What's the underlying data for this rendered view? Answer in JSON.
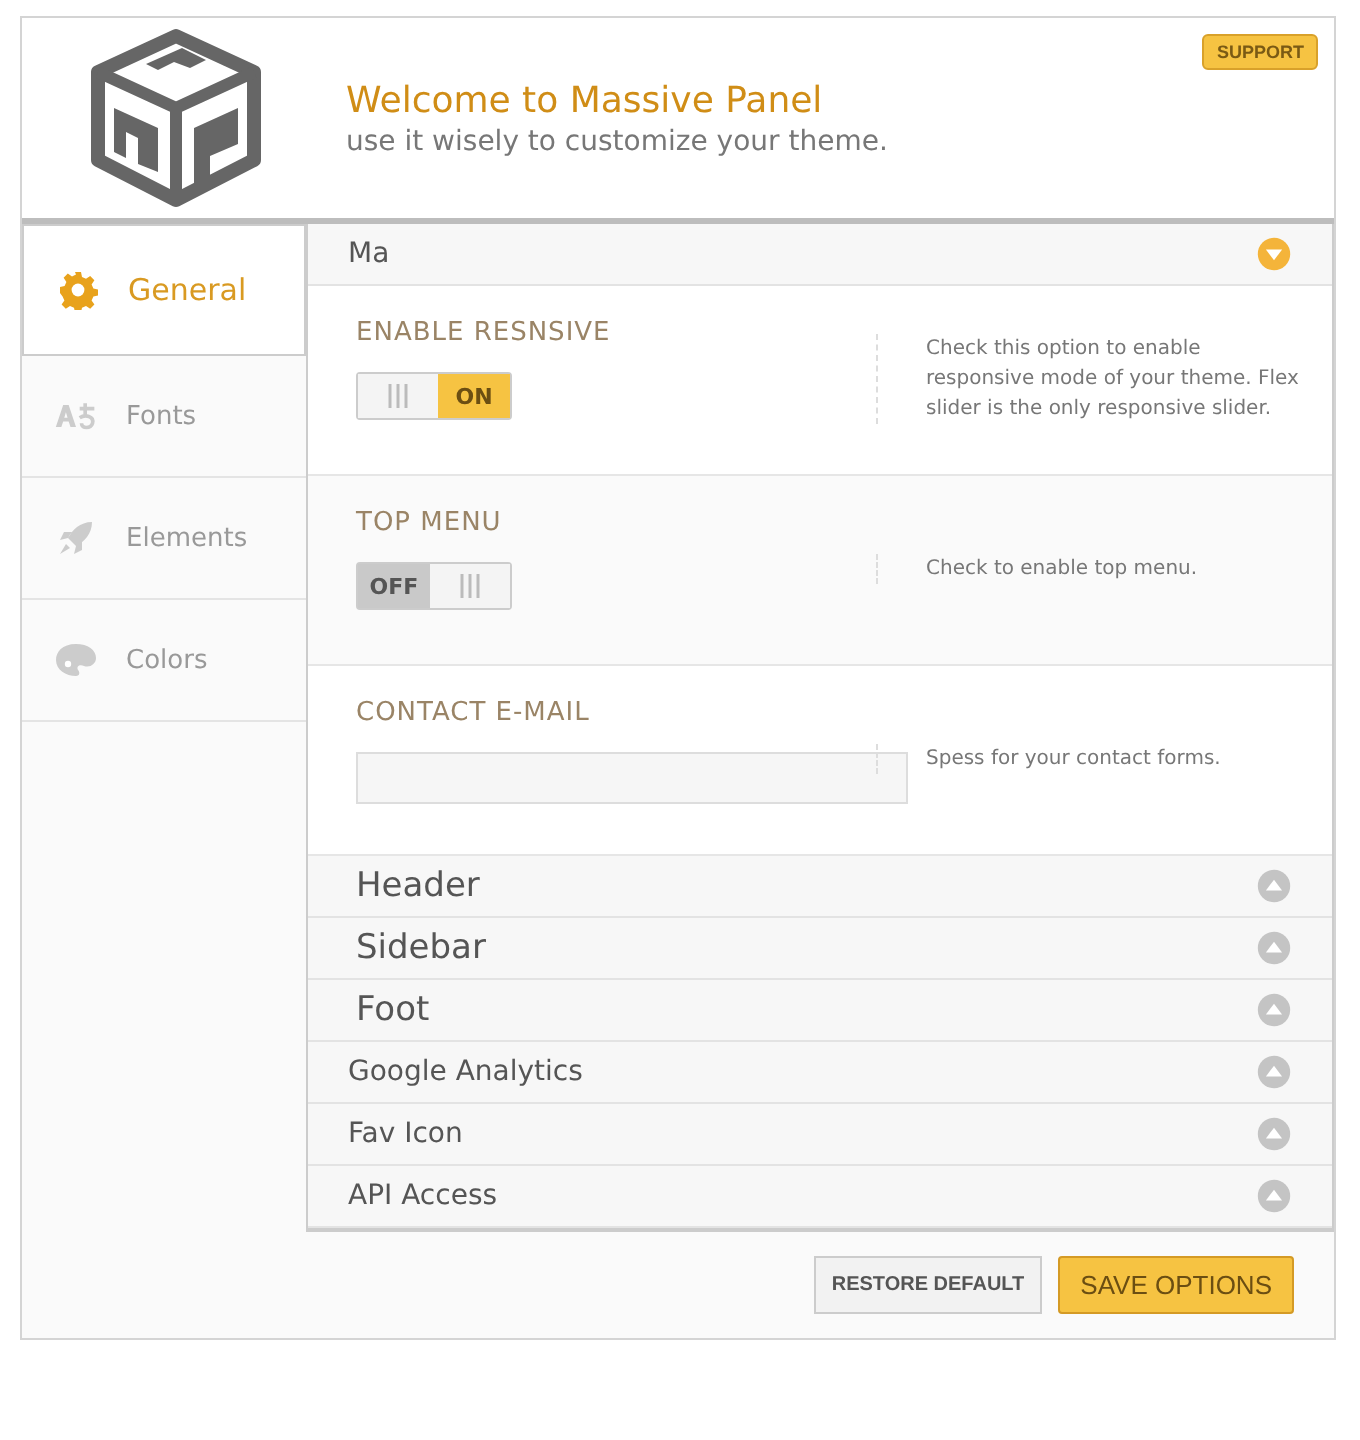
{
  "header": {
    "title": "Welcome to Massive Panel",
    "subtitle": "use it wisely to customize your theme.",
    "support_button": "SUPPORT"
  },
  "sidebar": {
    "items": [
      {
        "label": "General",
        "selected": true
      },
      {
        "label": "Fonts",
        "selected": false
      },
      {
        "label": "Elements",
        "selected": false
      },
      {
        "label": "Colors",
        "selected": false
      }
    ]
  },
  "sections": [
    {
      "title": "Ma",
      "expanded": true,
      "options": [
        {
          "kind": "toggle",
          "label": "ENABLE RESNSIVE",
          "toggle": {
            "on": true,
            "label": "ON"
          },
          "description": "Check this option to enable responsive mode of your theme. Flex slider is the only responsive slider."
        },
        {
          "kind": "toggle",
          "label": "TOP MENU",
          "toggle": {
            "on": false,
            "label": "OFF"
          },
          "description": "Check to enable top menu."
        },
        {
          "kind": "text",
          "label": "CONTACT E-MAIL",
          "description": "Spess for your contact forms."
        }
      ]
    },
    {
      "title": "Header",
      "expanded": false
    },
    {
      "title": "Sidebar",
      "expanded": false
    },
    {
      "title": "Foot",
      "expanded": false
    },
    {
      "title": "Google Analytics",
      "expanded": false
    },
    {
      "title": "Fav Icon",
      "expanded": false
    },
    {
      "title": "API Access",
      "expanded": false
    }
  ],
  "footer": {
    "restore_button": "RESTORE DEFAULT",
    "save_button": "SAVE OPTIONS"
  }
}
